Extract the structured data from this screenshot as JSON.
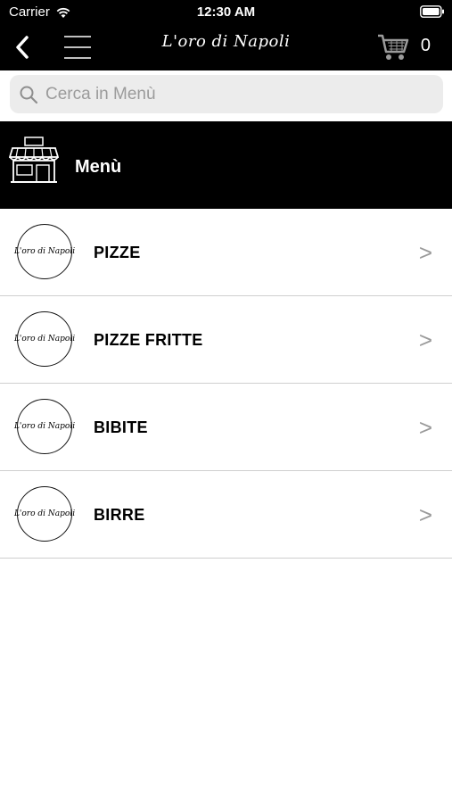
{
  "status_bar": {
    "carrier": "Carrier",
    "time": "12:30 AM"
  },
  "nav": {
    "brand": "L'oro di Napoli",
    "cart_count": "0"
  },
  "search": {
    "placeholder": "Cerca in Menù"
  },
  "section": {
    "title": "Menù"
  },
  "menu": {
    "items": [
      {
        "label": "PIZZE",
        "logo_text": "L'oro di Napoli",
        "chevron": ">"
      },
      {
        "label": "PIZZE FRITTE",
        "logo_text": "L'oro di Napoli",
        "chevron": ">"
      },
      {
        "label": "BIBITE",
        "logo_text": "L'oro di Napoli",
        "chevron": ">"
      },
      {
        "label": "BIRRE",
        "logo_text": "L'oro di Napoli",
        "chevron": ">"
      }
    ]
  },
  "icons": {
    "back": "chevron-left-icon",
    "menu": "hamburger-icon",
    "cart": "cart-icon",
    "search": "search-icon",
    "section": "store-icon"
  },
  "colors": {
    "bar": "#000000",
    "search_bg": "#ececec",
    "chevron": "#9a9a9a",
    "divider": "#cfcfcf"
  }
}
